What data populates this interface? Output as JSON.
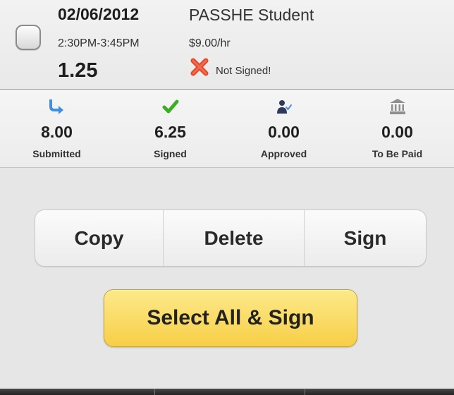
{
  "entry": {
    "date": "02/06/2012",
    "time_range": "2:30PM-3:45PM",
    "hours": "1.25",
    "job_title": "PASSHE Student",
    "rate": "$9.00/hr",
    "status_text": "Not Signed!",
    "status_icon": "red-x-icon",
    "checked": false
  },
  "stats": [
    {
      "value": "8.00",
      "label": "Submitted",
      "icon": "submitted-arrow-icon"
    },
    {
      "value": "6.25",
      "label": "Signed",
      "icon": "checkmark-icon"
    },
    {
      "value": "0.00",
      "label": "Approved",
      "icon": "approver-person-icon"
    },
    {
      "value": "0.00",
      "label": "To Be Paid",
      "icon": "bank-icon"
    }
  ],
  "actions": {
    "copy_label": "Copy",
    "delete_label": "Delete",
    "sign_label": "Sign",
    "select_all_sign_label": "Select All & Sign"
  },
  "colors": {
    "signed_check": "#3cae24",
    "submitted_arrow": "#3f8fe0",
    "not_signed_x": "#e24a2b",
    "select_all_button": "#f7cf47"
  }
}
